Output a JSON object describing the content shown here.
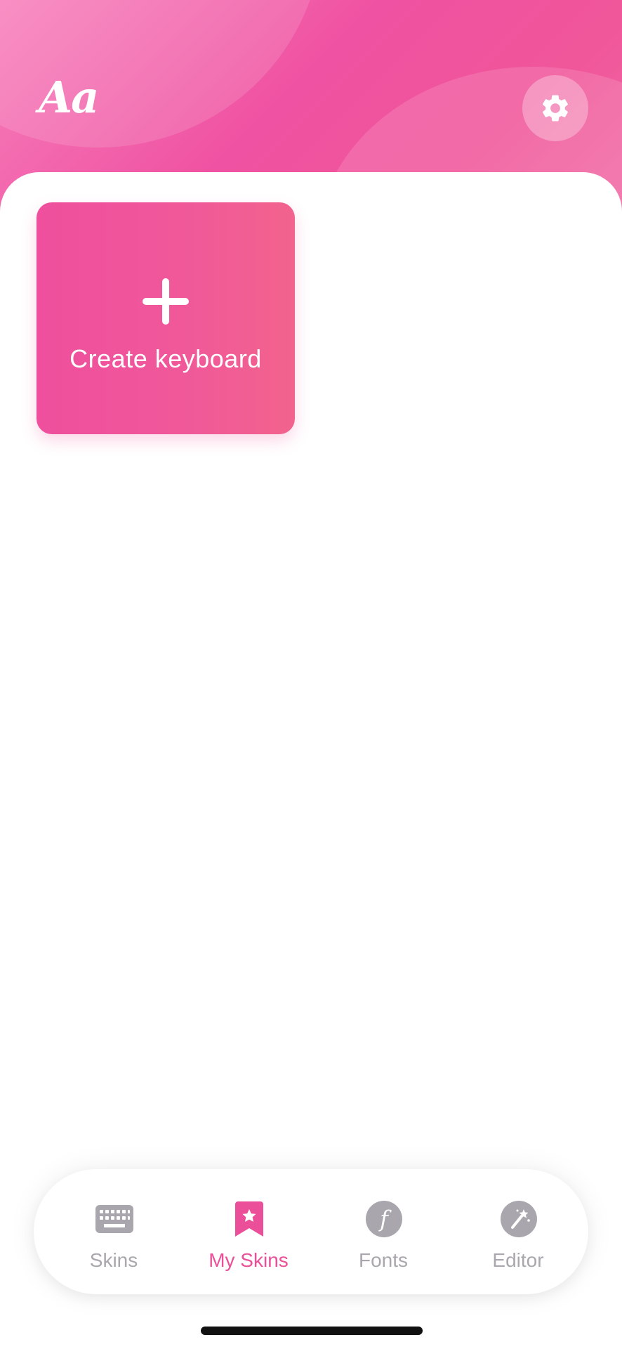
{
  "header": {
    "logo_text": "Aa",
    "settings_icon": "gear-icon"
  },
  "main": {
    "create_card": {
      "icon": "plus-icon",
      "label": "Create keyboard"
    }
  },
  "tabbar": {
    "active_tab": "My Skins",
    "tabs": [
      {
        "label": "Skins",
        "icon": "keyboard-icon"
      },
      {
        "label": "My Skins",
        "icon": "bookmark-star-icon"
      },
      {
        "label": "Fonts",
        "icon": "font-f-icon"
      },
      {
        "label": "Editor",
        "icon": "magic-wand-icon"
      }
    ]
  },
  "colors": {
    "accent": "#ec4f99",
    "header_gradient_start": "#f77fbb",
    "header_gradient_end": "#f06aa4",
    "card_gradient_start": "#ef4f9d",
    "card_gradient_end": "#f2638d",
    "tab_inactive": "#a9a7ad"
  }
}
